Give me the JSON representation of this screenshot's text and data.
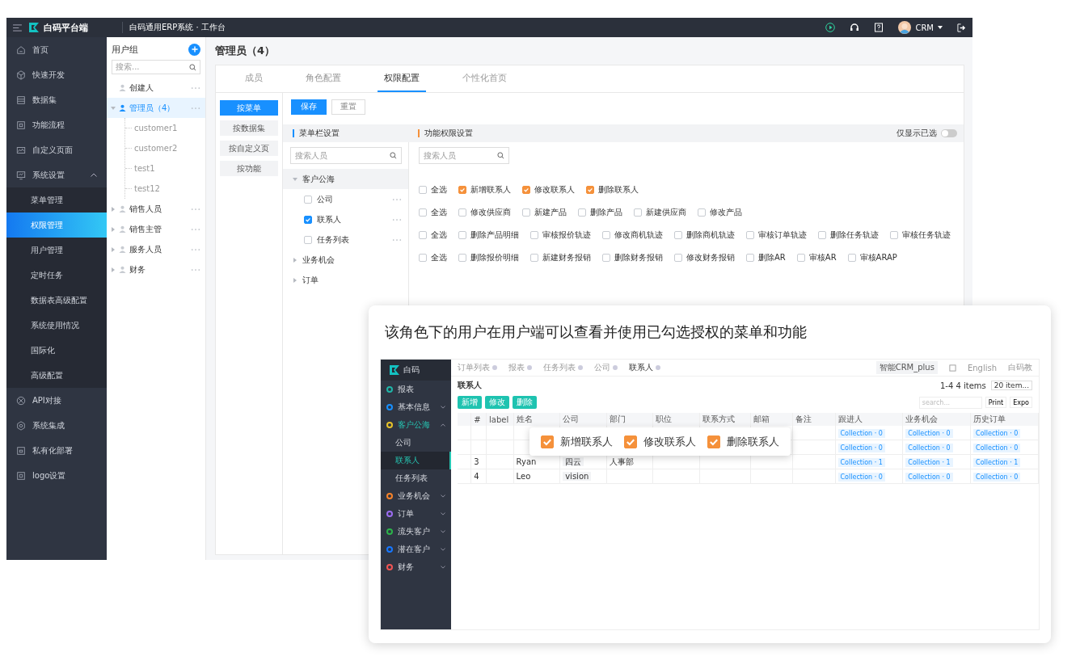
{
  "topbar": {
    "brand": "白码平台端",
    "title": "白码通用ERP系统 · 工作台",
    "user": "CRM"
  },
  "sidebar": {
    "items": [
      {
        "label": "首页"
      },
      {
        "label": "快速开发"
      },
      {
        "label": "数据集"
      },
      {
        "label": "功能流程"
      },
      {
        "label": "自定义页面"
      },
      {
        "label": "系统设置",
        "expanded": true,
        "children": [
          {
            "label": "菜单管理",
            "selected": false
          },
          {
            "label": "权限管理",
            "selected": true
          },
          {
            "label": "用户管理",
            "selected": false
          },
          {
            "label": "定时任务",
            "selected": false
          },
          {
            "label": "数据表高级配置",
            "selected": false
          },
          {
            "label": "系统使用情况",
            "selected": false
          },
          {
            "label": "国际化",
            "selected": false
          },
          {
            "label": "高级配置",
            "selected": false
          }
        ]
      },
      {
        "label": "API对接"
      },
      {
        "label": "系统集成"
      },
      {
        "label": "私有化部署"
      },
      {
        "label": "logo设置"
      }
    ]
  },
  "user_groups": {
    "title": "用户组",
    "search_placeholder": "搜索...",
    "groups": [
      {
        "label": "创建人",
        "selected": false
      },
      {
        "label": "管理员（4）",
        "selected": true,
        "expanded": true,
        "children": [
          {
            "label": "customer1"
          },
          {
            "label": "customer2"
          },
          {
            "label": "test1"
          },
          {
            "label": "test12"
          }
        ]
      },
      {
        "label": "销售人员",
        "selected": false,
        "expanded": false
      },
      {
        "label": "销售主管",
        "selected": false,
        "expanded": false
      },
      {
        "label": "服务人员",
        "selected": false,
        "expanded": false
      },
      {
        "label": "财务",
        "selected": false,
        "expanded": false
      }
    ]
  },
  "content": {
    "title": "管理员（4）",
    "tabs": [
      {
        "label": "成员",
        "selected": false
      },
      {
        "label": "角色配置",
        "selected": false
      },
      {
        "label": "权限配置",
        "selected": true
      },
      {
        "label": "个性化首页",
        "selected": false
      }
    ],
    "modes": [
      {
        "label": "按菜单",
        "selected": true
      },
      {
        "label": "按数据集",
        "selected": false
      },
      {
        "label": "按自定义页",
        "selected": false
      },
      {
        "label": "按功能",
        "selected": false
      }
    ],
    "save": "保存",
    "reset": "重置",
    "menu_panel": {
      "title": "菜单栏设置",
      "search_placeholder": "搜索人员",
      "tree": [
        {
          "label": "客户公海",
          "expanded": true,
          "children": [
            {
              "label": "公司",
              "checked": false
            },
            {
              "label": "联系人",
              "checked": true
            },
            {
              "label": "任务列表",
              "checked": false
            }
          ]
        },
        {
          "label": "业务机会",
          "expanded": false
        },
        {
          "label": "订单",
          "expanded": false
        }
      ]
    },
    "function_panel": {
      "title": "功能权限设置",
      "filter": {
        "label": "仅显示已选",
        "on": false
      },
      "search_placeholder": "搜索人员",
      "rows": [
        {
          "select_all": {
            "label": "全选",
            "checked": false
          },
          "items": [
            {
              "label": "新增联系人",
              "checked": true
            },
            {
              "label": "修改联系人",
              "checked": true
            },
            {
              "label": "删除联系人",
              "checked": true
            }
          ]
        },
        {
          "select_all": {
            "label": "全选",
            "checked": false
          },
          "items": [
            {
              "label": "修改供应商",
              "checked": false
            },
            {
              "label": "新建产品",
              "checked": false
            },
            {
              "label": "删除产品",
              "checked": false
            },
            {
              "label": "新建供应商",
              "checked": false
            },
            {
              "label": "修改产品",
              "checked": false
            }
          ]
        },
        {
          "select_all": {
            "label": "全选",
            "checked": false
          },
          "items": [
            {
              "label": "删除产品明细",
              "checked": false
            },
            {
              "label": "审核报价轨迹",
              "checked": false
            },
            {
              "label": "修改商机轨迹",
              "checked": false
            },
            {
              "label": "删除商机轨迹",
              "checked": false
            },
            {
              "label": "审核订单轨迹",
              "checked": false
            },
            {
              "label": "删除任务轨迹",
              "checked": false
            },
            {
              "label": "审核任务轨迹",
              "checked": false
            }
          ]
        },
        {
          "select_all": {
            "label": "全选",
            "checked": false
          },
          "items": [
            {
              "label": "删除报价明细",
              "checked": false
            },
            {
              "label": "新建财务报销",
              "checked": false
            },
            {
              "label": "删除财务报销",
              "checked": false
            },
            {
              "label": "修改财务报销",
              "checked": false
            },
            {
              "label": "删除AR",
              "checked": false
            },
            {
              "label": "审核AR",
              "checked": false
            },
            {
              "label": "审核ARAP",
              "checked": false
            }
          ]
        }
      ]
    }
  },
  "preview": {
    "caption": "该角色下的用户在用户端可以查看并使用已勾选授权的菜单和功能",
    "brand": "白码",
    "nav": [
      {
        "label": "报表",
        "color": "#1fb5a8"
      },
      {
        "label": "基本信息",
        "color": "#1890ff",
        "expanded": false
      },
      {
        "label": "客户公海",
        "color": "#e6c229",
        "expanded": true,
        "children": [
          {
            "label": "公司",
            "selected": false
          },
          {
            "label": "联系人",
            "selected": true
          },
          {
            "label": "任务列表",
            "selected": false
          }
        ]
      },
      {
        "label": "业务机会",
        "color": "#f5822a",
        "expanded": false
      },
      {
        "label": "订单",
        "color": "#9b6cf0",
        "expanded": false
      },
      {
        "label": "流失客户",
        "color": "#2cb34a",
        "expanded": false
      },
      {
        "label": "潜在客户",
        "color": "#1677ff",
        "expanded": false
      },
      {
        "label": "财务",
        "color": "#f05454",
        "expanded": false
      }
    ],
    "tabs": [
      {
        "label": "订单列表",
        "selected": false
      },
      {
        "label": "报表",
        "selected": false
      },
      {
        "label": "任务列表",
        "selected": false
      },
      {
        "label": "公司",
        "selected": false
      },
      {
        "label": "联系人",
        "selected": true
      }
    ],
    "app_name": "智能CRM_plus",
    "language": "English",
    "user": "白码教",
    "page_title": "联系人",
    "pagination": "1-4 4 items",
    "page_size": "20 item...",
    "buttons": [
      "新增",
      "修改",
      "删除"
    ],
    "search_placeholder": "search...",
    "print": "Print",
    "export": "Expo",
    "columns": [
      "#",
      "label",
      "姓名",
      "公司",
      "部门",
      "职位",
      "联系方式",
      "邮箱",
      "备注",
      "跟进人",
      "业务机会",
      "历史订单"
    ],
    "rows": [
      {
        "collections": [
          "Collection · 0",
          "Collection · 0",
          "Collection · 0"
        ]
      },
      {
        "collections": [
          "Collection · 0",
          "Collection · 0",
          "Collection · 0"
        ]
      },
      {
        "num": "3",
        "name": "Ryan",
        "company": "四云",
        "dept": "人事部",
        "collections": [
          "Collection · 1",
          "Collection · 1",
          "Collection · 1"
        ]
      },
      {
        "num": "4",
        "name": "Leo",
        "company": "vision",
        "collections": [
          "Collection · 0",
          "Collection · 0",
          "Collection · 0"
        ]
      }
    ],
    "popup": [
      {
        "label": "新增联系人",
        "checked": true
      },
      {
        "label": "修改联系人",
        "checked": true
      },
      {
        "label": "删除联系人",
        "checked": true
      }
    ]
  }
}
